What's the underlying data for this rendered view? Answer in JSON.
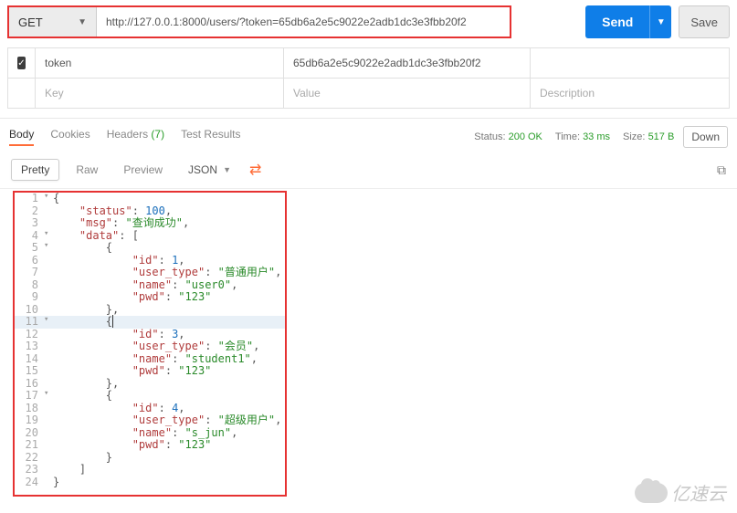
{
  "request": {
    "method": "GET",
    "url": "http://127.0.0.1:8000/users/?token=65db6a2e5c9022e2adb1dc3e3fbb20f2",
    "send_label": "Send",
    "save_label": "Save"
  },
  "params": {
    "rows": [
      {
        "checked": true,
        "key": "token",
        "value": "65db6a2e5c9022e2adb1dc3e3fbb20f2",
        "desc": ""
      }
    ],
    "placeholder_row": {
      "key": "Key",
      "value": "Value",
      "desc": "Description"
    }
  },
  "response": {
    "tabs": {
      "body": "Body",
      "cookies": "Cookies",
      "headers": "Headers",
      "headers_count": "(7)",
      "tests": "Test Results"
    },
    "meta": {
      "status_label": "Status:",
      "status_value": "200 OK",
      "time_label": "Time:",
      "time_value": "33 ms",
      "size_label": "Size:",
      "size_value": "517 B"
    },
    "download_label": "Down"
  },
  "body_toolbar": {
    "pretty": "Pretty",
    "raw": "Raw",
    "preview": "Preview",
    "format": "JSON"
  },
  "json_body": {
    "status": 100,
    "msg": "查询成功",
    "data": [
      {
        "id": 1,
        "user_type": "普通用户",
        "name": "user0",
        "pwd": "123"
      },
      {
        "id": 3,
        "user_type": "会员",
        "name": "student1",
        "pwd": "123"
      },
      {
        "id": 4,
        "user_type": "超级用户",
        "name": "s_jun",
        "pwd": "123"
      }
    ]
  },
  "code_lines": [
    {
      "n": 1,
      "fold": "▾",
      "indent": 0,
      "tokens": [
        {
          "t": "punc",
          "v": "{"
        }
      ]
    },
    {
      "n": 2,
      "indent": 1,
      "tokens": [
        {
          "t": "key",
          "v": "\"status\""
        },
        {
          "t": "punc",
          "v": ": "
        },
        {
          "t": "num",
          "v": "100"
        },
        {
          "t": "punc",
          "v": ","
        }
      ]
    },
    {
      "n": 3,
      "indent": 1,
      "tokens": [
        {
          "t": "key",
          "v": "\"msg\""
        },
        {
          "t": "punc",
          "v": ": "
        },
        {
          "t": "str",
          "v": "\"查询成功\""
        },
        {
          "t": "punc",
          "v": ","
        }
      ]
    },
    {
      "n": 4,
      "fold": "▾",
      "indent": 1,
      "tokens": [
        {
          "t": "key",
          "v": "\"data\""
        },
        {
          "t": "punc",
          "v": ": ["
        }
      ]
    },
    {
      "n": 5,
      "fold": "▾",
      "indent": 2,
      "tokens": [
        {
          "t": "punc",
          "v": "{"
        }
      ]
    },
    {
      "n": 6,
      "indent": 3,
      "tokens": [
        {
          "t": "key",
          "v": "\"id\""
        },
        {
          "t": "punc",
          "v": ": "
        },
        {
          "t": "num",
          "v": "1"
        },
        {
          "t": "punc",
          "v": ","
        }
      ]
    },
    {
      "n": 7,
      "indent": 3,
      "tokens": [
        {
          "t": "key",
          "v": "\"user_type\""
        },
        {
          "t": "punc",
          "v": ": "
        },
        {
          "t": "str",
          "v": "\"普通用户\""
        },
        {
          "t": "punc",
          "v": ","
        }
      ]
    },
    {
      "n": 8,
      "indent": 3,
      "tokens": [
        {
          "t": "key",
          "v": "\"name\""
        },
        {
          "t": "punc",
          "v": ": "
        },
        {
          "t": "str",
          "v": "\"user0\""
        },
        {
          "t": "punc",
          "v": ","
        }
      ]
    },
    {
      "n": 9,
      "indent": 3,
      "tokens": [
        {
          "t": "key",
          "v": "\"pwd\""
        },
        {
          "t": "punc",
          "v": ": "
        },
        {
          "t": "str",
          "v": "\"123\""
        }
      ]
    },
    {
      "n": 10,
      "indent": 2,
      "tokens": [
        {
          "t": "punc",
          "v": "},"
        }
      ]
    },
    {
      "n": 11,
      "fold": "▾",
      "hl": true,
      "indent": 2,
      "tokens": [
        {
          "t": "punc",
          "v": "{"
        },
        {
          "t": "cursor",
          "v": ""
        }
      ]
    },
    {
      "n": 12,
      "indent": 3,
      "tokens": [
        {
          "t": "key",
          "v": "\"id\""
        },
        {
          "t": "punc",
          "v": ": "
        },
        {
          "t": "num",
          "v": "3"
        },
        {
          "t": "punc",
          "v": ","
        }
      ]
    },
    {
      "n": 13,
      "indent": 3,
      "tokens": [
        {
          "t": "key",
          "v": "\"user_type\""
        },
        {
          "t": "punc",
          "v": ": "
        },
        {
          "t": "str",
          "v": "\"会员\""
        },
        {
          "t": "punc",
          "v": ","
        }
      ]
    },
    {
      "n": 14,
      "indent": 3,
      "tokens": [
        {
          "t": "key",
          "v": "\"name\""
        },
        {
          "t": "punc",
          "v": ": "
        },
        {
          "t": "str",
          "v": "\"student1\""
        },
        {
          "t": "punc",
          "v": ","
        }
      ]
    },
    {
      "n": 15,
      "indent": 3,
      "tokens": [
        {
          "t": "key",
          "v": "\"pwd\""
        },
        {
          "t": "punc",
          "v": ": "
        },
        {
          "t": "str",
          "v": "\"123\""
        }
      ]
    },
    {
      "n": 16,
      "indent": 2,
      "tokens": [
        {
          "t": "punc",
          "v": "},"
        }
      ]
    },
    {
      "n": 17,
      "fold": "▾",
      "indent": 2,
      "tokens": [
        {
          "t": "punc",
          "v": "{"
        }
      ]
    },
    {
      "n": 18,
      "indent": 3,
      "tokens": [
        {
          "t": "key",
          "v": "\"id\""
        },
        {
          "t": "punc",
          "v": ": "
        },
        {
          "t": "num",
          "v": "4"
        },
        {
          "t": "punc",
          "v": ","
        }
      ]
    },
    {
      "n": 19,
      "indent": 3,
      "tokens": [
        {
          "t": "key",
          "v": "\"user_type\""
        },
        {
          "t": "punc",
          "v": ": "
        },
        {
          "t": "str",
          "v": "\"超级用户\""
        },
        {
          "t": "punc",
          "v": ","
        }
      ]
    },
    {
      "n": 20,
      "indent": 3,
      "tokens": [
        {
          "t": "key",
          "v": "\"name\""
        },
        {
          "t": "punc",
          "v": ": "
        },
        {
          "t": "str",
          "v": "\"s_jun\""
        },
        {
          "t": "punc",
          "v": ","
        }
      ]
    },
    {
      "n": 21,
      "indent": 3,
      "tokens": [
        {
          "t": "key",
          "v": "\"pwd\""
        },
        {
          "t": "punc",
          "v": ": "
        },
        {
          "t": "str",
          "v": "\"123\""
        }
      ]
    },
    {
      "n": 22,
      "indent": 2,
      "tokens": [
        {
          "t": "punc",
          "v": "}"
        }
      ]
    },
    {
      "n": 23,
      "indent": 1,
      "tokens": [
        {
          "t": "punc",
          "v": "]"
        }
      ]
    },
    {
      "n": 24,
      "indent": 0,
      "tokens": [
        {
          "t": "punc",
          "v": "}"
        }
      ]
    }
  ],
  "watermark": "亿速云"
}
